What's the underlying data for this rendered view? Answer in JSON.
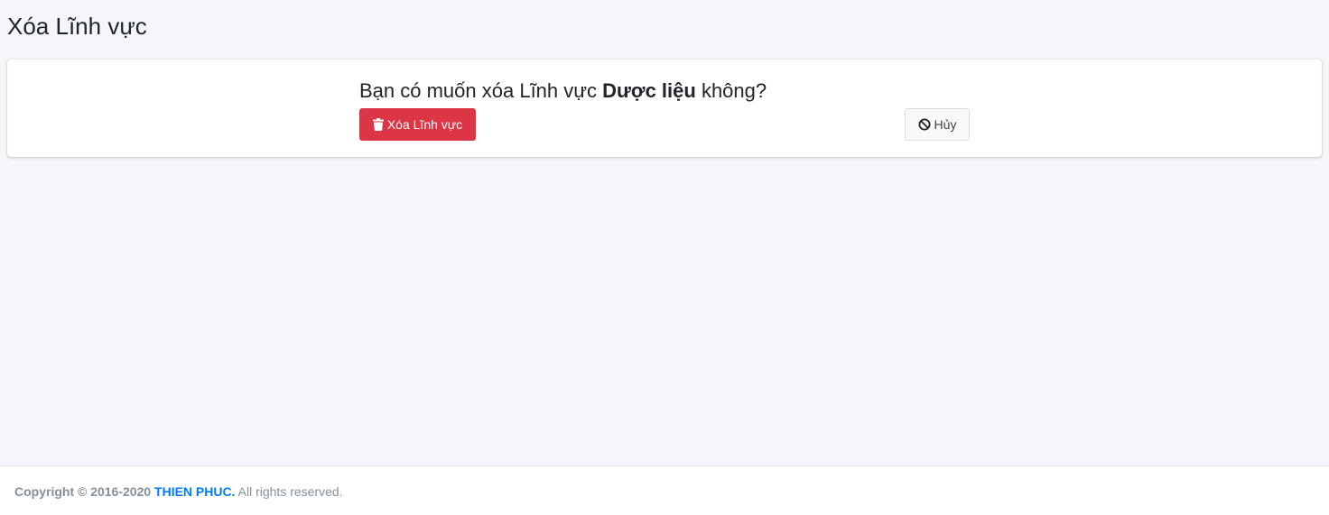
{
  "page": {
    "title": "Xóa Lĩnh vực"
  },
  "confirm": {
    "prefix": "Bạn có muốn xóa Lĩnh vực ",
    "item_name": "Dược liệu",
    "suffix": " không?"
  },
  "actions": {
    "delete_label": "Xóa Lĩnh vực",
    "delete_icon": "trash-icon",
    "cancel_label": "Hủy",
    "cancel_icon": "ban-icon"
  },
  "footer": {
    "copyright_prefix": "Copyright © 2016-2020 ",
    "company": "THIEN PHUC.",
    "rights": " All rights reserved."
  },
  "colors": {
    "danger": "#dc3545",
    "link": "#007bff",
    "background": "#f4f6f9"
  }
}
